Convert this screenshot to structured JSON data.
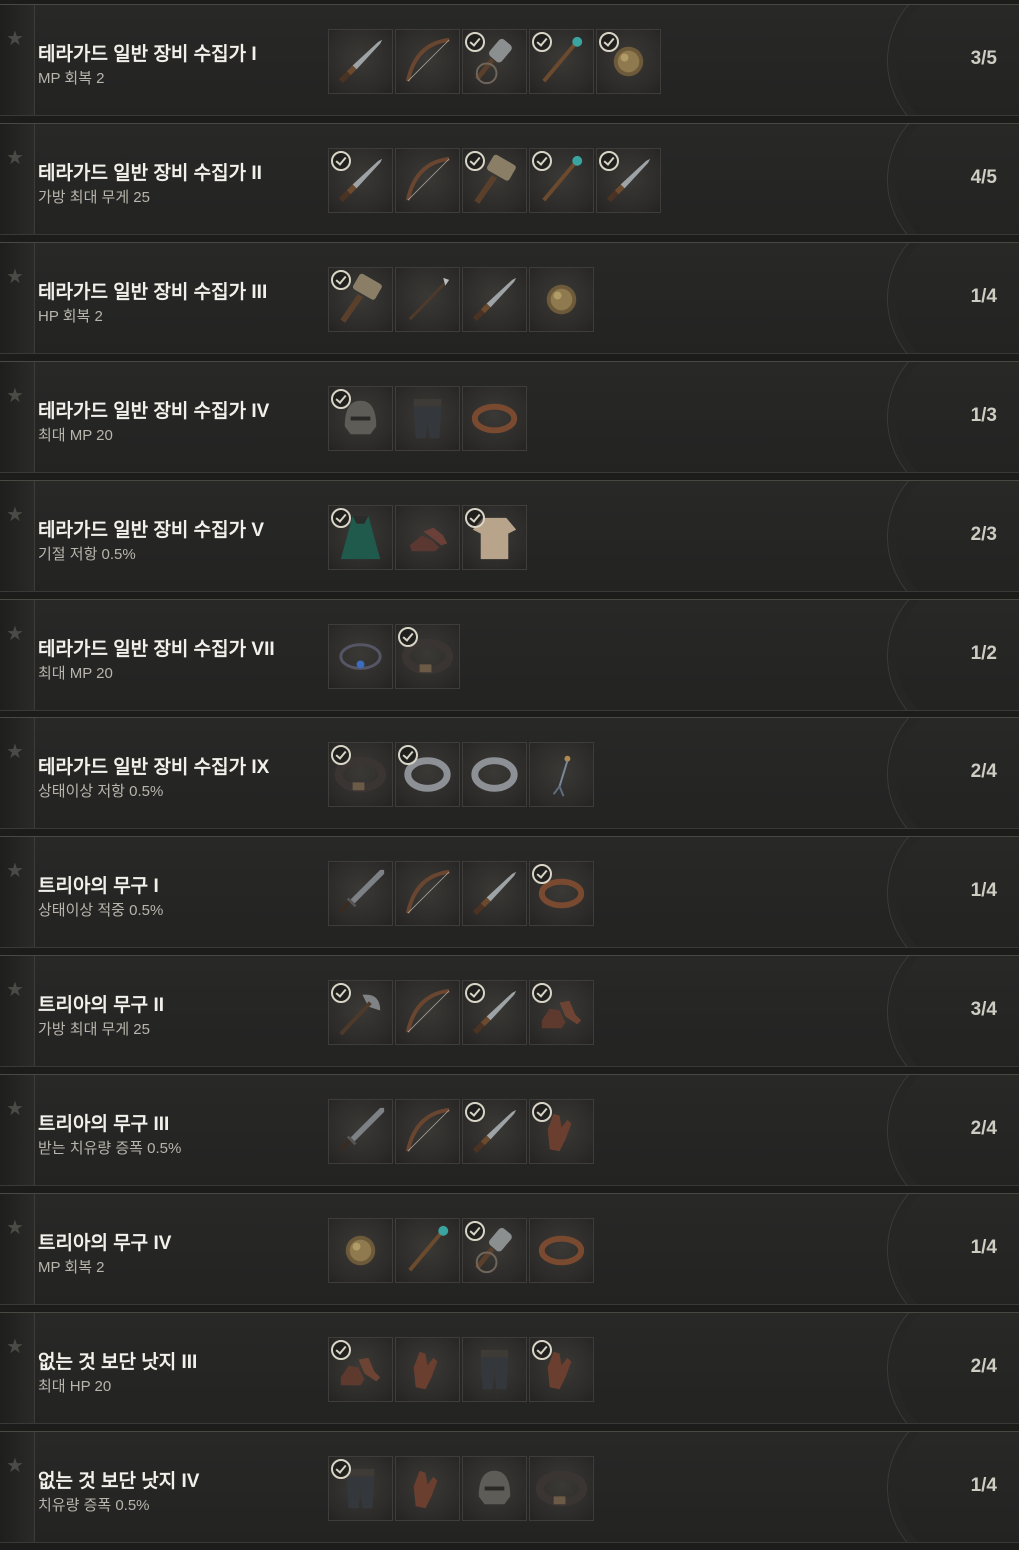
{
  "sets": [
    {
      "title": "테라가드 일반 장비 수집가 I",
      "bonus": "MP 회복 2",
      "progress": "3/5",
      "items": [
        {
          "icon": "dagger-icon",
          "collected": false
        },
        {
          "icon": "bow-icon",
          "collected": false
        },
        {
          "icon": "mace-icon",
          "collected": true
        },
        {
          "icon": "staff-icon",
          "collected": true
        },
        {
          "icon": "orb-icon",
          "collected": true
        }
      ]
    },
    {
      "title": "테라가드 일반 장비 수집가 II",
      "bonus": "가방 최대 무게 25",
      "progress": "4/5",
      "items": [
        {
          "icon": "dagger-icon",
          "collected": true
        },
        {
          "icon": "bow-icon",
          "collected": false
        },
        {
          "icon": "hammer-icon",
          "collected": true
        },
        {
          "icon": "staff-icon",
          "collected": true
        },
        {
          "icon": "dagger-icon",
          "collected": true
        }
      ]
    },
    {
      "title": "테라가드 일반 장비 수집가 III",
      "bonus": "HP 회복 2",
      "progress": "1/4",
      "items": [
        {
          "icon": "hammer-icon",
          "collected": true
        },
        {
          "icon": "spear-icon",
          "collected": false
        },
        {
          "icon": "dagger-icon",
          "collected": false
        },
        {
          "icon": "orb-icon",
          "collected": false
        }
      ]
    },
    {
      "title": "테라가드 일반 장비 수집가 IV",
      "bonus": "최대 MP 20",
      "progress": "1/3",
      "items": [
        {
          "icon": "helmet-icon",
          "collected": true
        },
        {
          "icon": "pants-icon",
          "collected": false
        },
        {
          "icon": "bracelet-icon",
          "collected": false
        }
      ]
    },
    {
      "title": "테라가드 일반 장비 수집가 V",
      "bonus": "기절 저항 0.5%",
      "progress": "2/3",
      "items": [
        {
          "icon": "cloak-icon",
          "collected": true
        },
        {
          "icon": "shoes-icon",
          "collected": false
        },
        {
          "icon": "shirt-icon",
          "collected": true
        }
      ]
    },
    {
      "title": "테라가드 일반 장비 수집가 VII",
      "bonus": "최대 MP 20",
      "progress": "1/2",
      "items": [
        {
          "icon": "necklace-icon",
          "collected": false
        },
        {
          "icon": "belt-icon",
          "collected": true
        }
      ]
    },
    {
      "title": "테라가드 일반 장비 수집가 IX",
      "bonus": "상태이상 저항 0.5%",
      "progress": "2/4",
      "items": [
        {
          "icon": "belt-icon",
          "collected": true
        },
        {
          "icon": "ring-icon",
          "collected": true
        },
        {
          "icon": "ring-icon",
          "collected": false
        },
        {
          "icon": "earring-icon",
          "collected": false
        }
      ]
    },
    {
      "title": "트리아의 무구 I",
      "bonus": "상태이상 적중 0.5%",
      "progress": "1/4",
      "items": [
        {
          "icon": "sword-icon",
          "collected": false
        },
        {
          "icon": "bow-icon",
          "collected": false
        },
        {
          "icon": "dagger-icon",
          "collected": false
        },
        {
          "icon": "bracelet-icon",
          "collected": true
        }
      ]
    },
    {
      "title": "트리아의 무구 II",
      "bonus": "가방 최대 무게 25",
      "progress": "3/4",
      "items": [
        {
          "icon": "axe-icon",
          "collected": true
        },
        {
          "icon": "bow-icon",
          "collected": false
        },
        {
          "icon": "dagger-icon",
          "collected": true
        },
        {
          "icon": "boots-icon",
          "collected": true
        }
      ]
    },
    {
      "title": "트리아의 무구 III",
      "bonus": "받는 치유량 증폭 0.5%",
      "progress": "2/4",
      "items": [
        {
          "icon": "sword-icon",
          "collected": false
        },
        {
          "icon": "bow-icon",
          "collected": false
        },
        {
          "icon": "dagger-icon",
          "collected": true
        },
        {
          "icon": "gloves-icon",
          "collected": true
        }
      ]
    },
    {
      "title": "트리아의 무구 IV",
      "bonus": "MP 회복 2",
      "progress": "1/4",
      "items": [
        {
          "icon": "orb-icon",
          "collected": false
        },
        {
          "icon": "staff-icon",
          "collected": false
        },
        {
          "icon": "mace-icon",
          "collected": true
        },
        {
          "icon": "bracelet-icon",
          "collected": false
        }
      ]
    },
    {
      "title": "없는 것 보단 낫지 III",
      "bonus": "최대 HP 20",
      "progress": "2/4",
      "items": [
        {
          "icon": "boots-icon",
          "collected": true
        },
        {
          "icon": "gloves-icon",
          "collected": false
        },
        {
          "icon": "pants-icon",
          "collected": false
        },
        {
          "icon": "gloves-icon",
          "collected": true
        }
      ]
    },
    {
      "title": "없는 것 보단 낫지 IV",
      "bonus": "치유량 증폭 0.5%",
      "progress": "1/4",
      "items": [
        {
          "icon": "pants-icon",
          "collected": true
        },
        {
          "icon": "gloves-icon",
          "collected": false
        },
        {
          "icon": "helmet-icon",
          "collected": false
        },
        {
          "icon": "belt-icon",
          "collected": false
        }
      ]
    }
  ]
}
